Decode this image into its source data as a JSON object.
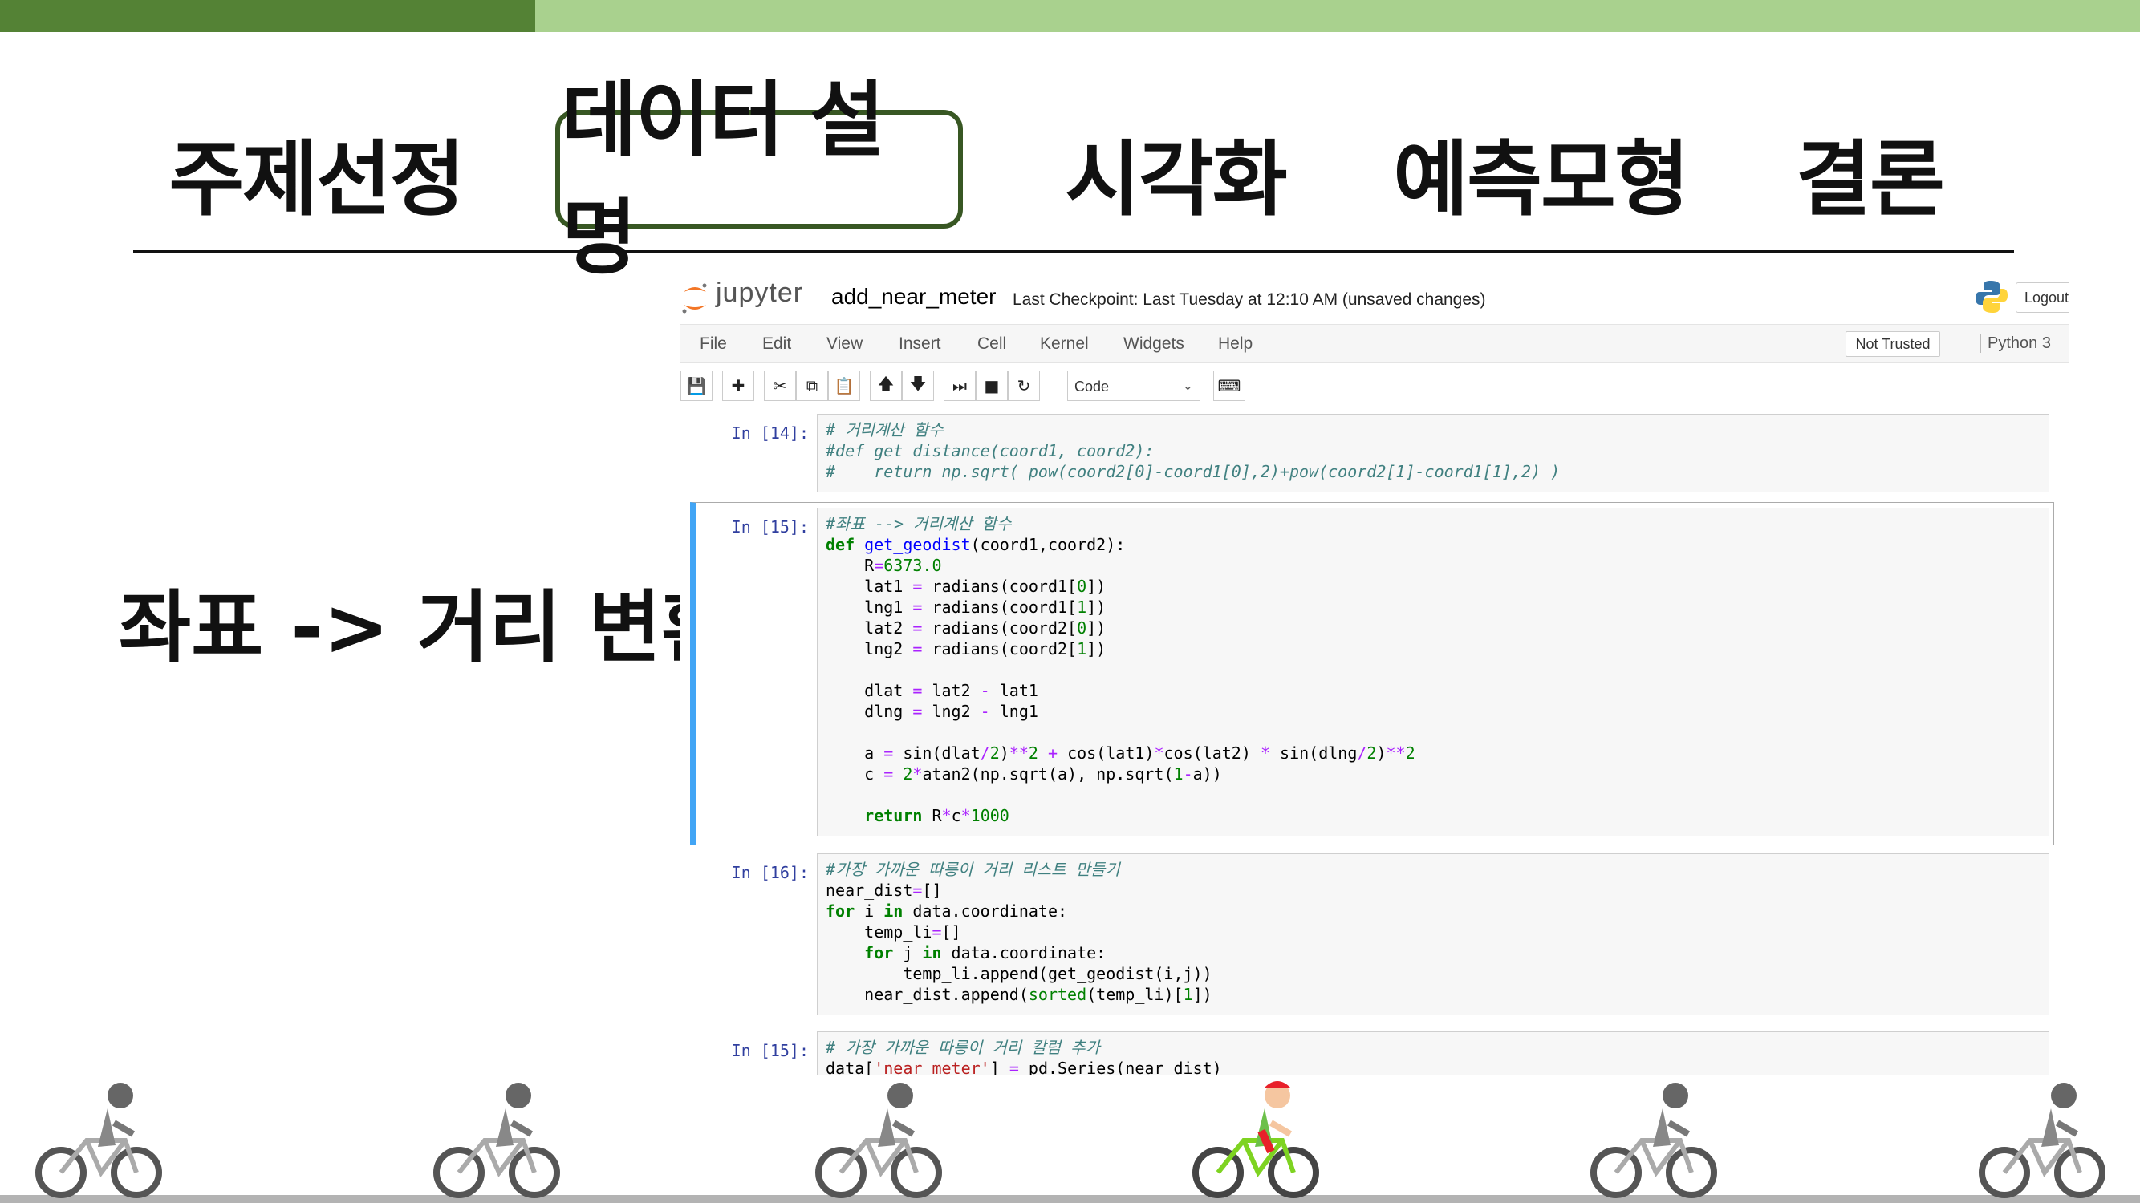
{
  "nav": {
    "items": [
      "주제선정",
      "데이터 설명",
      "시각화",
      "예측모형",
      "결론"
    ],
    "active_index": 1
  },
  "side_title": "좌표 -> 거리 변환",
  "jupyter": {
    "logo_text": "jupyter",
    "notebook_name": "add_near_meter",
    "checkpoint": "Last Checkpoint: Last Tuesday at 12:10 AM (unsaved changes)",
    "logout": "Logout",
    "menus": [
      "File",
      "Edit",
      "View",
      "Insert",
      "Cell",
      "Kernel",
      "Widgets",
      "Help"
    ],
    "trust": "Not Trusted",
    "kernel": "Python 3",
    "cell_type": "Code",
    "toolbar_icons": [
      "save-icon",
      "plus-icon",
      "cut-icon",
      "copy-icon",
      "paste-icon",
      "arrow-up-icon",
      "arrow-down-icon",
      "run-icon",
      "stop-icon",
      "restart-icon",
      "keyboard-icon"
    ]
  },
  "cells": [
    {
      "prompt": "In [14]:",
      "lines": [
        "# 거리계산 함수",
        "#def get_distance(coord1, coord2):",
        "#    return np.sqrt( pow(coord2[0]-coord1[0],2)+pow(coord2[1]-coord1[1],2) )"
      ]
    },
    {
      "prompt": "In [15]:",
      "lines": [
        "#좌표 --> 거리계산 함수",
        "def get_geodist(coord1,coord2):",
        "    R=6373.0",
        "    lat1 = radians(coord1[0])",
        "    lng1 = radians(coord1[1])",
        "    lat2 = radians(coord2[0])",
        "    lng2 = radians(coord2[1])",
        "",
        "    dlat = lat2 - lat1",
        "    dlng = lng2 - lng1",
        "",
        "    a = sin(dlat/2)**2 + cos(lat1)*cos(lat2) * sin(dlng/2)**2",
        "    c = 2*atan2(np.sqrt(a), np.sqrt(1-a))",
        "",
        "    return R*c*1000"
      ]
    },
    {
      "prompt": "In [16]:",
      "lines": [
        "#가장 가까운 따릉이 거리 리스트 만들기",
        "near_dist=[]",
        "for i in data.coordinate:",
        "    temp_li=[]",
        "    for j in data.coordinate:",
        "        temp_li.append(get_geodist(i,j))",
        "    near_dist.append(sorted(temp_li)[1])"
      ]
    },
    {
      "prompt": "In [15]:",
      "lines": [
        "# 가장 가까운 따릉이 거리 칼럼 추가",
        "data['near_meter'] = pd.Series(near_dist)"
      ]
    }
  ],
  "colors": {
    "top_bar_light": "#a9d18e",
    "top_bar_dark": "#548235",
    "active_border": "#385723",
    "cell_selected": "#42a5f5"
  }
}
